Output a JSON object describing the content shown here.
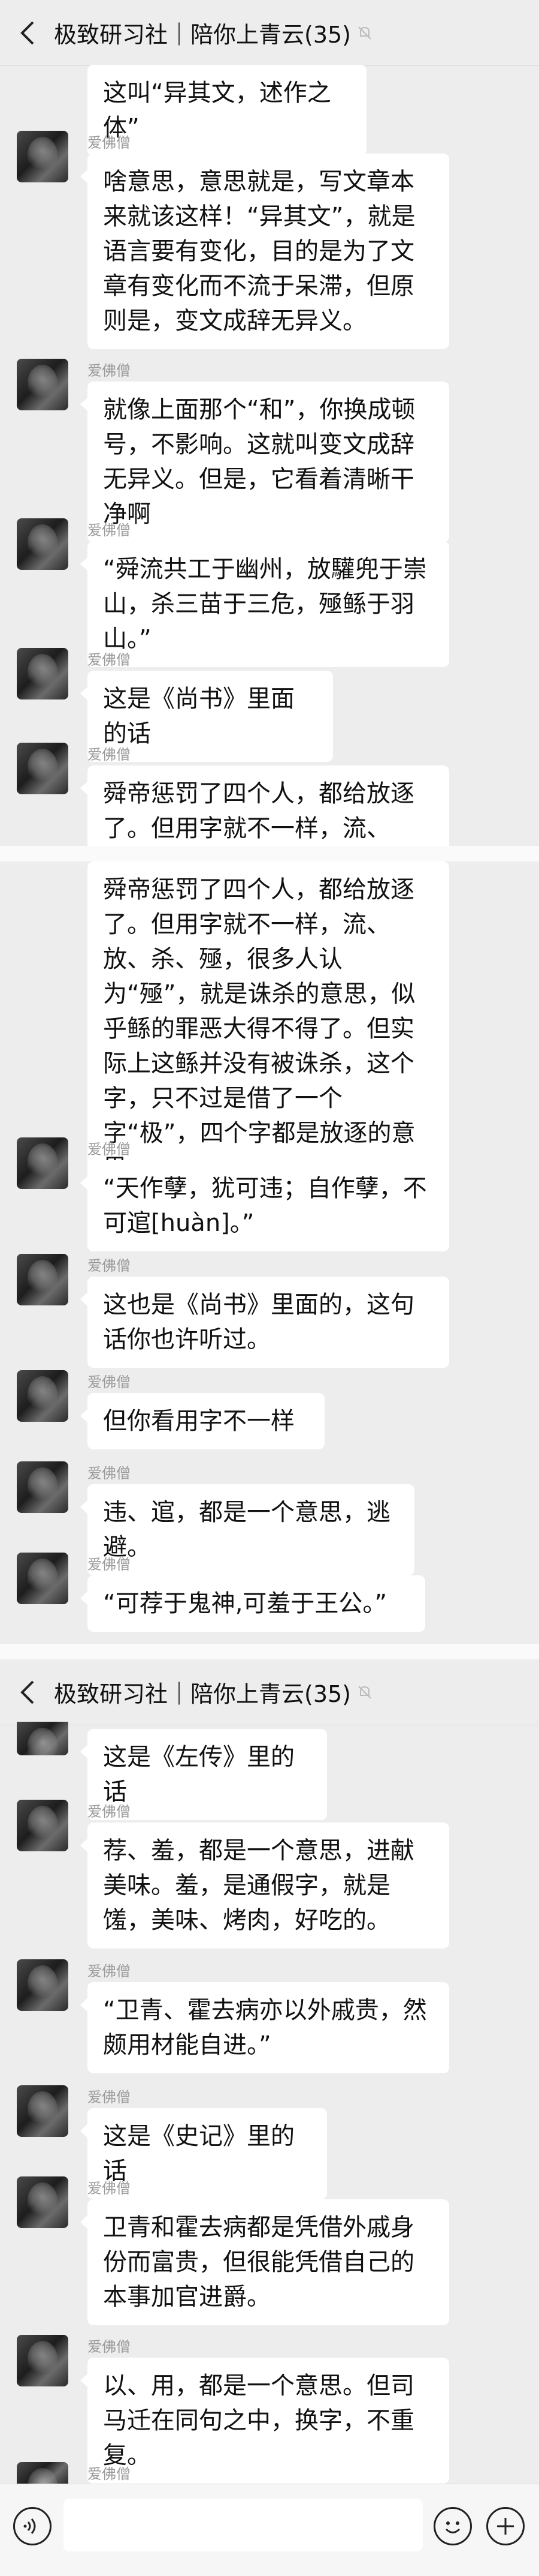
{
  "header": {
    "title": "极致研习社｜陪你上青云(35)"
  },
  "sender": {
    "nickname": "爱佛僧"
  },
  "messages_part1": [
    {
      "text": "这叫“异其文，述作之体”"
    },
    {
      "text": "啥意思，意思就是，写文章本来就该这样！“异其文”，就是语言要有变化，目的是为了文章有变化而不流于呆滞，但原则是，变文成辞无异义。"
    },
    {
      "text": "就像上面那个“和”，你换成顿号，不影响。这就叫变文成辞无异义。但是，它看着清晰干净啊"
    },
    {
      "text": "“舜流共工于幽州，放驩兜于崇山，杀三苗于三危，殛鲧于羽山。”"
    },
    {
      "text": "这是《尚书》里面的话"
    },
    {
      "text": "舜帝惩罚了四个人，都给放逐了。但用字就不一样，流、放、杀、殛，很"
    }
  ],
  "messages_part2": [
    {
      "text": "舜帝惩罚了四个人，都给放逐了。但用字就不一样，流、放、杀、殛，很多人认为“殛”，就是诛杀的意思，似乎鲧的罪恶大得不得了。但实际上这鲧并没有被诛杀，这个字，只不过是借了一个字“极”，四个字都是放逐的意思。"
    },
    {
      "text": "“天作孽，犹可违；自作孽，不可逭[huàn]。”"
    },
    {
      "text": "这也是《尚书》里面的，这句话你也许听过。"
    },
    {
      "text": "但你看用字不一样"
    },
    {
      "text": "违、逭，都是一个意思，逃避。"
    },
    {
      "text": "“可荐于鬼神,可羞于王公。”"
    }
  ],
  "messages_part3": [
    {
      "text": "这是《左传》里的话"
    },
    {
      "text": "荐、羞，都是一个意思，进献美味。羞，是通假字，就是馐，美味、烤肉，好吃的。"
    },
    {
      "text": "“卫青、霍去病亦以外戚贵，然颇用材能自进。”"
    },
    {
      "text": "这是《史记》里的话"
    },
    {
      "text": "卫青和霍去病都是凭借外戚身份而富贵，但很能凭借自己的本事加官进爵。"
    },
    {
      "text": "以、用，都是一个意思。但司马迁在同句之中，换字，不重复。"
    }
  ],
  "icons": {
    "back": "chevron-left-icon",
    "mute": "mute-bell-icon",
    "voice": "voice-icon",
    "emoji": "emoji-icon",
    "plus": "plus-icon"
  }
}
